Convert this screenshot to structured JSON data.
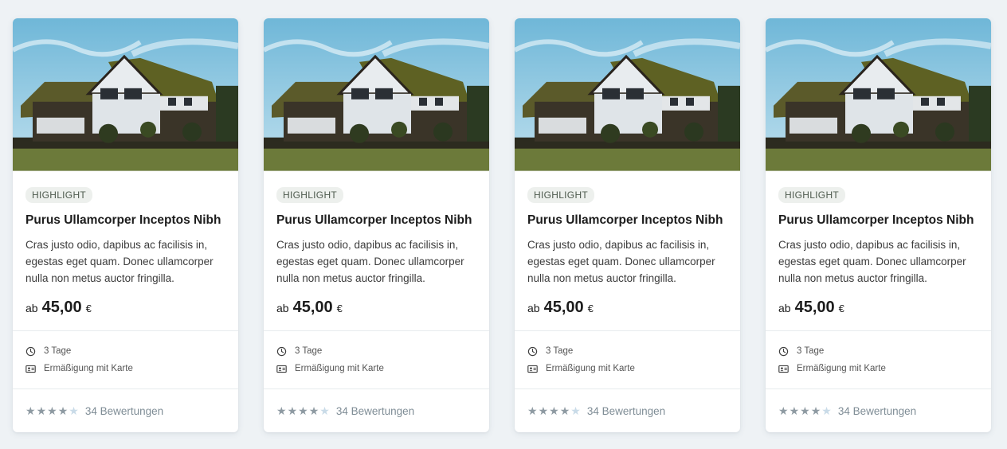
{
  "cards": [
    {
      "badge": "HIGHLIGHT",
      "title": "Purus Ullamcorper Inceptos Nibh",
      "description": "Cras justo odio, dapibus ac facilisis in, egestas eget quam. Donec ullamcorper nulla non metus auctor fringilla.",
      "price_prefix": "ab",
      "price": "45,00",
      "currency": "€",
      "duration": "3 Tage",
      "discount": "Ermäßigung mit Karte",
      "rating": 4,
      "rating_max": 5,
      "reviews": "34 Bewertungen"
    },
    {
      "badge": "HIGHLIGHT",
      "title": "Purus Ullamcorper Inceptos Nibh",
      "description": "Cras justo odio, dapibus ac facilisis in, egestas eget quam. Donec ullamcorper nulla non metus auctor fringilla.",
      "price_prefix": "ab",
      "price": "45,00",
      "currency": "€",
      "duration": "3 Tage",
      "discount": "Ermäßigung mit Karte",
      "rating": 4,
      "rating_max": 5,
      "reviews": "34 Bewertungen"
    },
    {
      "badge": "HIGHLIGHT",
      "title": "Purus Ullamcorper Inceptos Nibh",
      "description": "Cras justo odio, dapibus ac facilisis in, egestas eget quam. Donec ullamcorper nulla non metus auctor fringilla.",
      "price_prefix": "ab",
      "price": "45,00",
      "currency": "€",
      "duration": "3 Tage",
      "discount": "Ermäßigung mit Karte",
      "rating": 4,
      "rating_max": 5,
      "reviews": "34 Bewertungen"
    },
    {
      "badge": "HIGHLIGHT",
      "title": "Purus Ullamcorper Inceptos Nibh",
      "description": "Cras justo odio, dapibus ac facilisis in, egestas eget quam. Donec ullamcorper nulla non metus auctor fringilla.",
      "price_prefix": "ab",
      "price": "45,00",
      "currency": "€",
      "duration": "3 Tage",
      "discount": "Ermäßigung mit Karte",
      "rating": 4,
      "rating_max": 5,
      "reviews": "34 Bewertungen"
    }
  ],
  "icons": {
    "duration": "clock-icon",
    "discount": "id-card-icon",
    "rating": "star-icon"
  },
  "colors": {
    "background": "#eef2f5",
    "badge_bg": "#edf0ed",
    "star_filled": "#8e9aa2",
    "star_empty": "#c9dbe8"
  }
}
